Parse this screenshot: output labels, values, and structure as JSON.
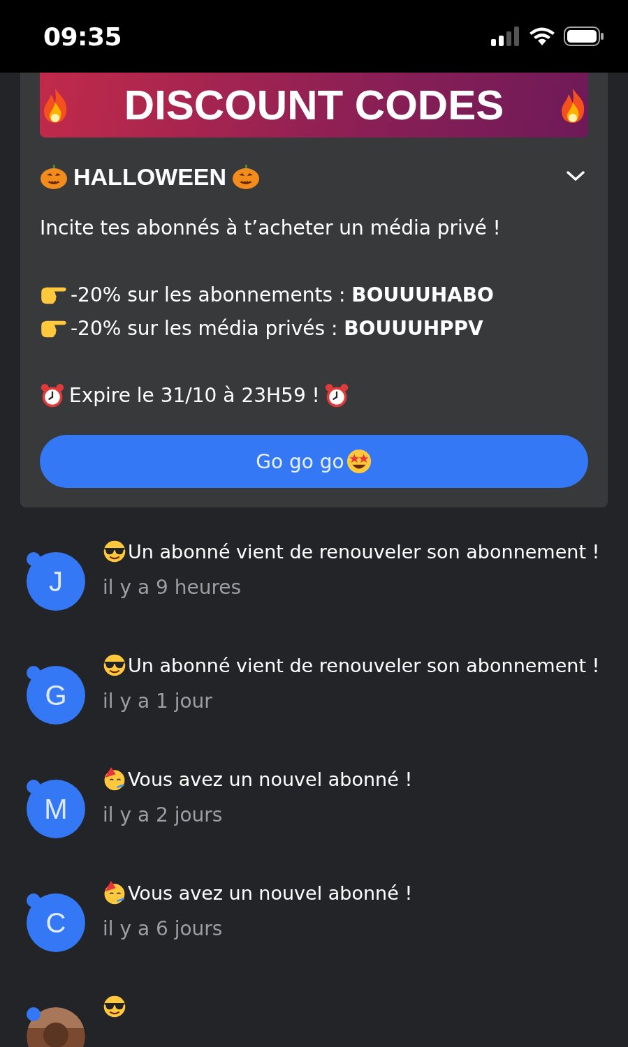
{
  "status_bar": {
    "time": "09:35"
  },
  "promo": {
    "banner": "DISCOUNT CODES",
    "title": "HALLOWEEN",
    "expanded": true,
    "intro": "Incite tes abonnés à t’acheter un média privé !",
    "codes": [
      "-20% sur les abonnements : **BOUUUHABO**",
      "-20% sur les média privés : **BOUUUHPPV**"
    ],
    "expiry": "Expire le 31/10 à 23H59 !",
    "button": "Go go go"
  },
  "notifications": [
    {
      "kind": "renewal",
      "initial": "J",
      "unread": true,
      "message": "Un abonné vient de renouveler son abonnement !",
      "time": "il y a 9 heures"
    },
    {
      "kind": "renewal",
      "initial": "G",
      "unread": true,
      "message": "Un abonné vient de renouveler son abonnement !",
      "time": "il y a 1 jour"
    },
    {
      "kind": "new_subscriber",
      "initial": "M",
      "unread": true,
      "message": "Vous avez un nouvel abonné !",
      "time": "il y a 2 jours"
    },
    {
      "kind": "new_subscriber",
      "initial": "C",
      "unread": true,
      "message": "Vous avez un nouvel abonné !",
      "time": "il y a 6 jours"
    },
    {
      "kind": "renewal",
      "unread": true
    }
  ]
}
